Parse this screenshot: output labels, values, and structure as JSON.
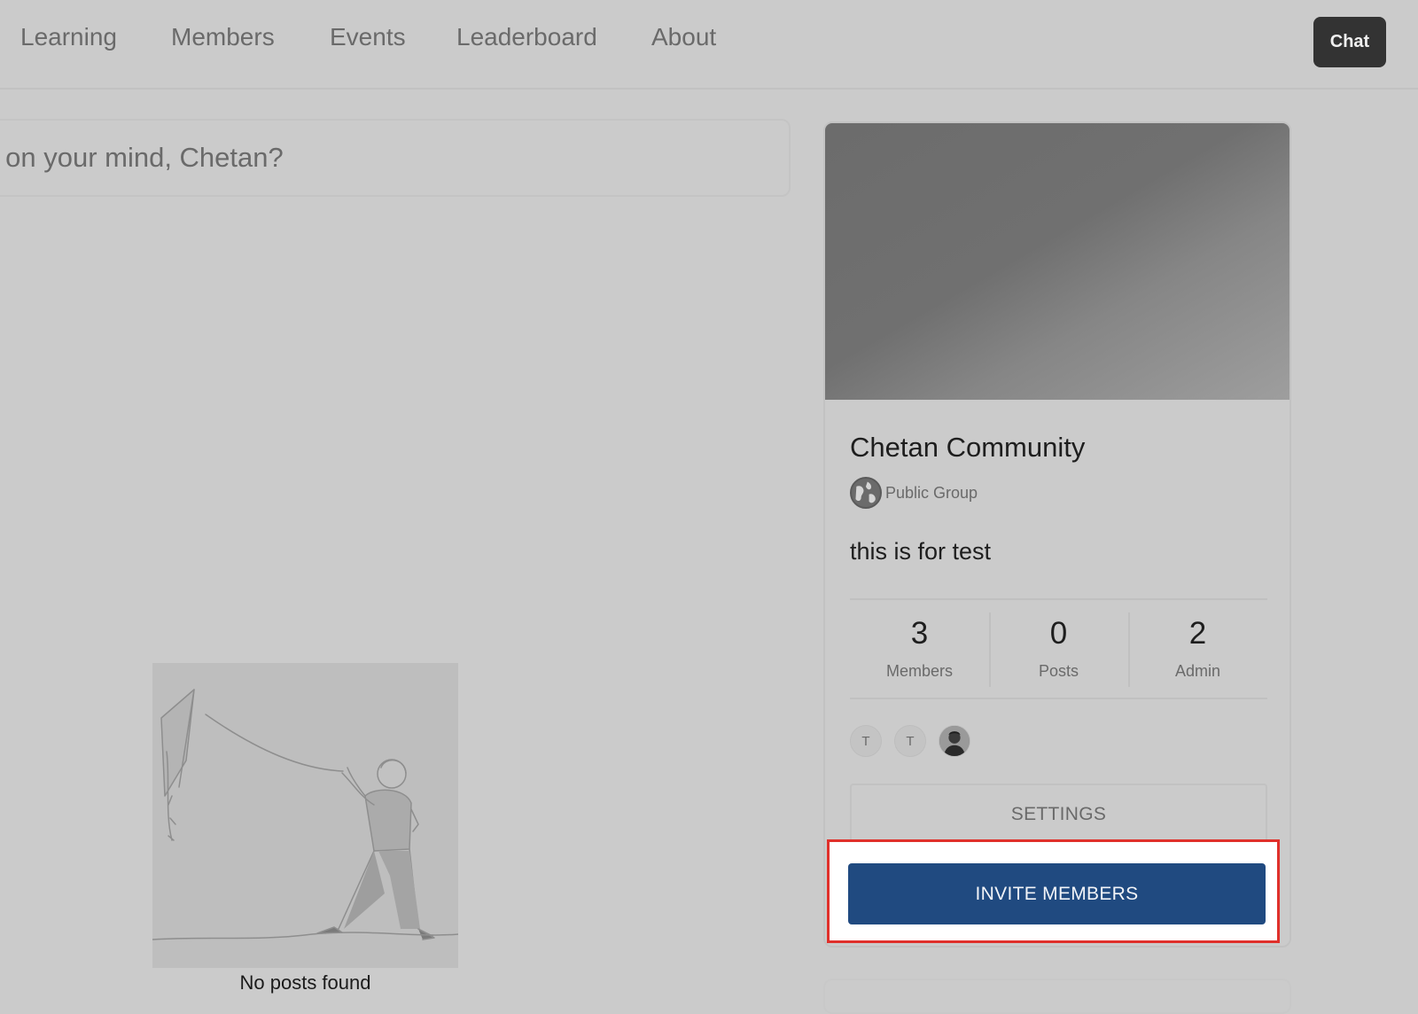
{
  "nav": {
    "items": [
      {
        "label": "Learning"
      },
      {
        "label": "Members"
      },
      {
        "label": "Events"
      },
      {
        "label": "Leaderboard"
      },
      {
        "label": "About"
      }
    ],
    "chat_label": "Chat"
  },
  "composer": {
    "placeholder": "s on your mind, Chetan?"
  },
  "feed": {
    "empty_caption": "No posts found"
  },
  "community": {
    "name": "Chetan Community",
    "type_label": "Public Group",
    "type_icon": "globe-icon",
    "description": "this is for test",
    "stats": [
      {
        "value": "3",
        "label": "Members"
      },
      {
        "value": "0",
        "label": "Posts"
      },
      {
        "value": "2",
        "label": "Admin"
      }
    ],
    "avatars": [
      {
        "initial": "T"
      },
      {
        "initial": "T"
      },
      {
        "initial": ""
      }
    ],
    "settings_label": "SETTINGS",
    "invite_label": "INVITE MEMBERS"
  },
  "colors": {
    "background": "#cbcbcb",
    "invite_button": "#204a80",
    "chat_button": "#333333",
    "highlight_outline": "#e0302b"
  }
}
